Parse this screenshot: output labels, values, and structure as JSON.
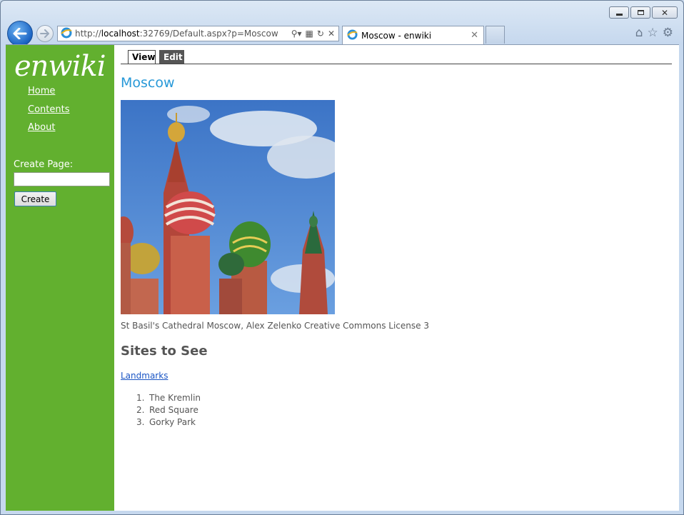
{
  "browser": {
    "address_url_prefix": "http://",
    "address_url_host": "localhost",
    "address_url_rest": ":32769/Default.aspx?p=Moscow",
    "tab_title": "Moscow - enwiki"
  },
  "sidebar": {
    "logo": "enwiki",
    "nav": [
      {
        "label": "Home"
      },
      {
        "label": "Contents"
      },
      {
        "label": "About"
      }
    ],
    "create_label": "Create Page:",
    "create_input_value": "",
    "create_button": "Create"
  },
  "page": {
    "tabs": [
      {
        "label": "View",
        "active": true
      },
      {
        "label": "Edit",
        "active": false
      }
    ],
    "title": "Moscow",
    "image_caption": "St Basil's Cathedral Moscow, Alex Zelenko Creative Commons License 3",
    "section_heading": "Sites to See",
    "link": "Landmarks",
    "list": [
      {
        "num": "1.",
        "text": "The Kremlin"
      },
      {
        "num": "2.",
        "text": "Red Square"
      },
      {
        "num": "3.",
        "text": "Gorky Park"
      }
    ]
  },
  "colors": {
    "sidebar": "#62b02f",
    "title": "#2899d8",
    "link": "#1a55c4"
  }
}
